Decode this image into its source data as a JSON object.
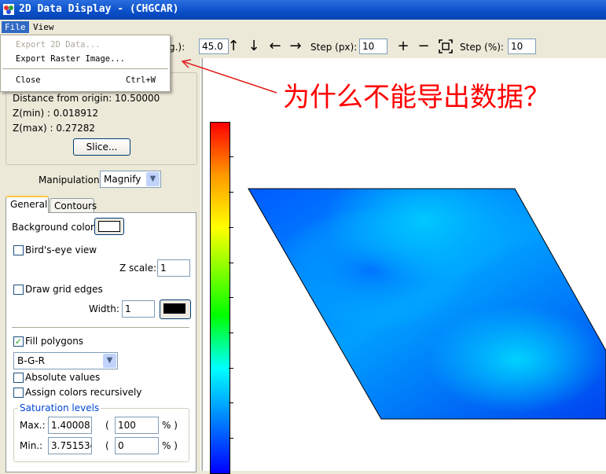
{
  "window": {
    "title": "2D Data Display - (CHGCAR)"
  },
  "menubar": {
    "file": "File",
    "view": "View"
  },
  "file_menu": {
    "export_2d": "Export 2D Data...",
    "export_raster": "Export Raster Image...",
    "close": "Close",
    "close_shortcut": "Ctrl+W"
  },
  "toolbar": {
    "angle_label_fragment": "g.):",
    "angle_value": "45.0",
    "step_px_label": "Step (px):",
    "step_px_value": "10",
    "step_pct_label": "Step (%):",
    "step_pct_value": "10"
  },
  "info": {
    "distance": "Distance from origin: 10.50000",
    "zmin": "Z(min) : 0.018912",
    "zmax": "Z(max) : 0.27282",
    "slice_button": "Slice..."
  },
  "manipulation": {
    "label": "Manipulation:",
    "value": "Magnify"
  },
  "tabs": {
    "general": "General",
    "contours": "Contours"
  },
  "general": {
    "background_color_label": "Background color:",
    "birds_eye_label": "Bird's-eye view",
    "birds_eye_checked": false,
    "zscale_label": "Z scale:",
    "zscale_value": "1",
    "draw_grid_label": "Draw grid edges",
    "draw_grid_checked": false,
    "width_label": "Width:",
    "width_value": "1",
    "fill_polygons_label": "Fill polygons",
    "fill_polygons_checked": true,
    "colormap_value": "B-G-R",
    "absolute_values_label": "Absolute values",
    "assign_colors_label": "Assign colors recursively"
  },
  "saturation": {
    "legend": "Saturation levels",
    "max_label": "Max.:",
    "max_value": "1.40008",
    "max_pct": "100",
    "min_label": "Min.:",
    "min_value": "3.75153e",
    "min_pct": "0",
    "open_paren": "(",
    "pct_close": "% )"
  },
  "annotation": {
    "text": "为什么不能导出数据？",
    "color": "#FF0000"
  },
  "colors": {
    "titlebar": "#0A4FC8",
    "highlight": "#316AC5",
    "annotation": "#FF0000"
  }
}
